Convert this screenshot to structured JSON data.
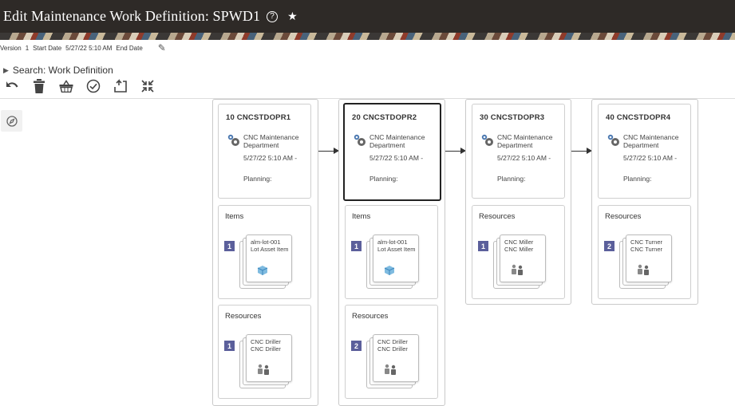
{
  "header": {
    "title": "Edit Maintenance Work Definition: SPWD1",
    "help_icon": "help-icon",
    "favorite_icon": "star-icon"
  },
  "meta": {
    "version_label": "Version",
    "version_value": "1",
    "start_label": "Start Date",
    "start_value": "5/27/22 5:10 AM",
    "end_label": "End Date",
    "end_value": ""
  },
  "search": {
    "label": "Search: Work Definition"
  },
  "toolbar": {
    "icons": [
      "undo-icon",
      "delete-icon",
      "basket-icon",
      "check-circle-icon",
      "publish-icon",
      "collapse-icon"
    ]
  },
  "left": {
    "icon": "compass-icon"
  },
  "operations": [
    {
      "name": "10 CNCSTDOPR1",
      "dept_line1": "CNC Maintenance",
      "dept_line2": "Department",
      "date": "5/27/22 5:10 AM -",
      "planning": "Planning:",
      "sections": [
        {
          "header": "Items",
          "count": "1",
          "line1": "alm-lot-001",
          "line2": "Lot Asset Item",
          "icon": "cube-icon"
        },
        {
          "header": "Resources",
          "count": "1",
          "line1": "CNC Driller",
          "line2": "CNC Driller",
          "icon": "people-icon"
        }
      ]
    },
    {
      "name": "20 CNCSTDOPR2",
      "dept_line1": "CNC Maintenance",
      "dept_line2": "Department",
      "date": "5/27/22 5:10 AM -",
      "planning": "Planning:",
      "sections": [
        {
          "header": "Items",
          "count": "1",
          "line1": "alm-lot-001",
          "line2": "Lot Asset Item",
          "icon": "cube-icon"
        },
        {
          "header": "Resources",
          "count": "2",
          "line1": "CNC Driller",
          "line2": "CNC Driller",
          "icon": "people-icon"
        }
      ]
    },
    {
      "name": "30 CNCSTDOPR3",
      "dept_line1": "CNC Maintenance",
      "dept_line2": "Department",
      "date": "5/27/22 5:10 AM -",
      "planning": "Planning:",
      "sections": [
        {
          "header": "Resources",
          "count": "1",
          "line1": "CNC Miller",
          "line2": "CNC Miller",
          "icon": "people-icon"
        }
      ]
    },
    {
      "name": "40 CNCSTDOPR4",
      "dept_line1": "CNC Maintenance",
      "dept_line2": "Department",
      "date": "5/27/22 5:10 AM -",
      "planning": "Planning:",
      "sections": [
        {
          "header": "Resources",
          "count": "2",
          "line1": "CNC Turner",
          "line2": "CNC Turner",
          "icon": "people-icon"
        }
      ]
    }
  ]
}
